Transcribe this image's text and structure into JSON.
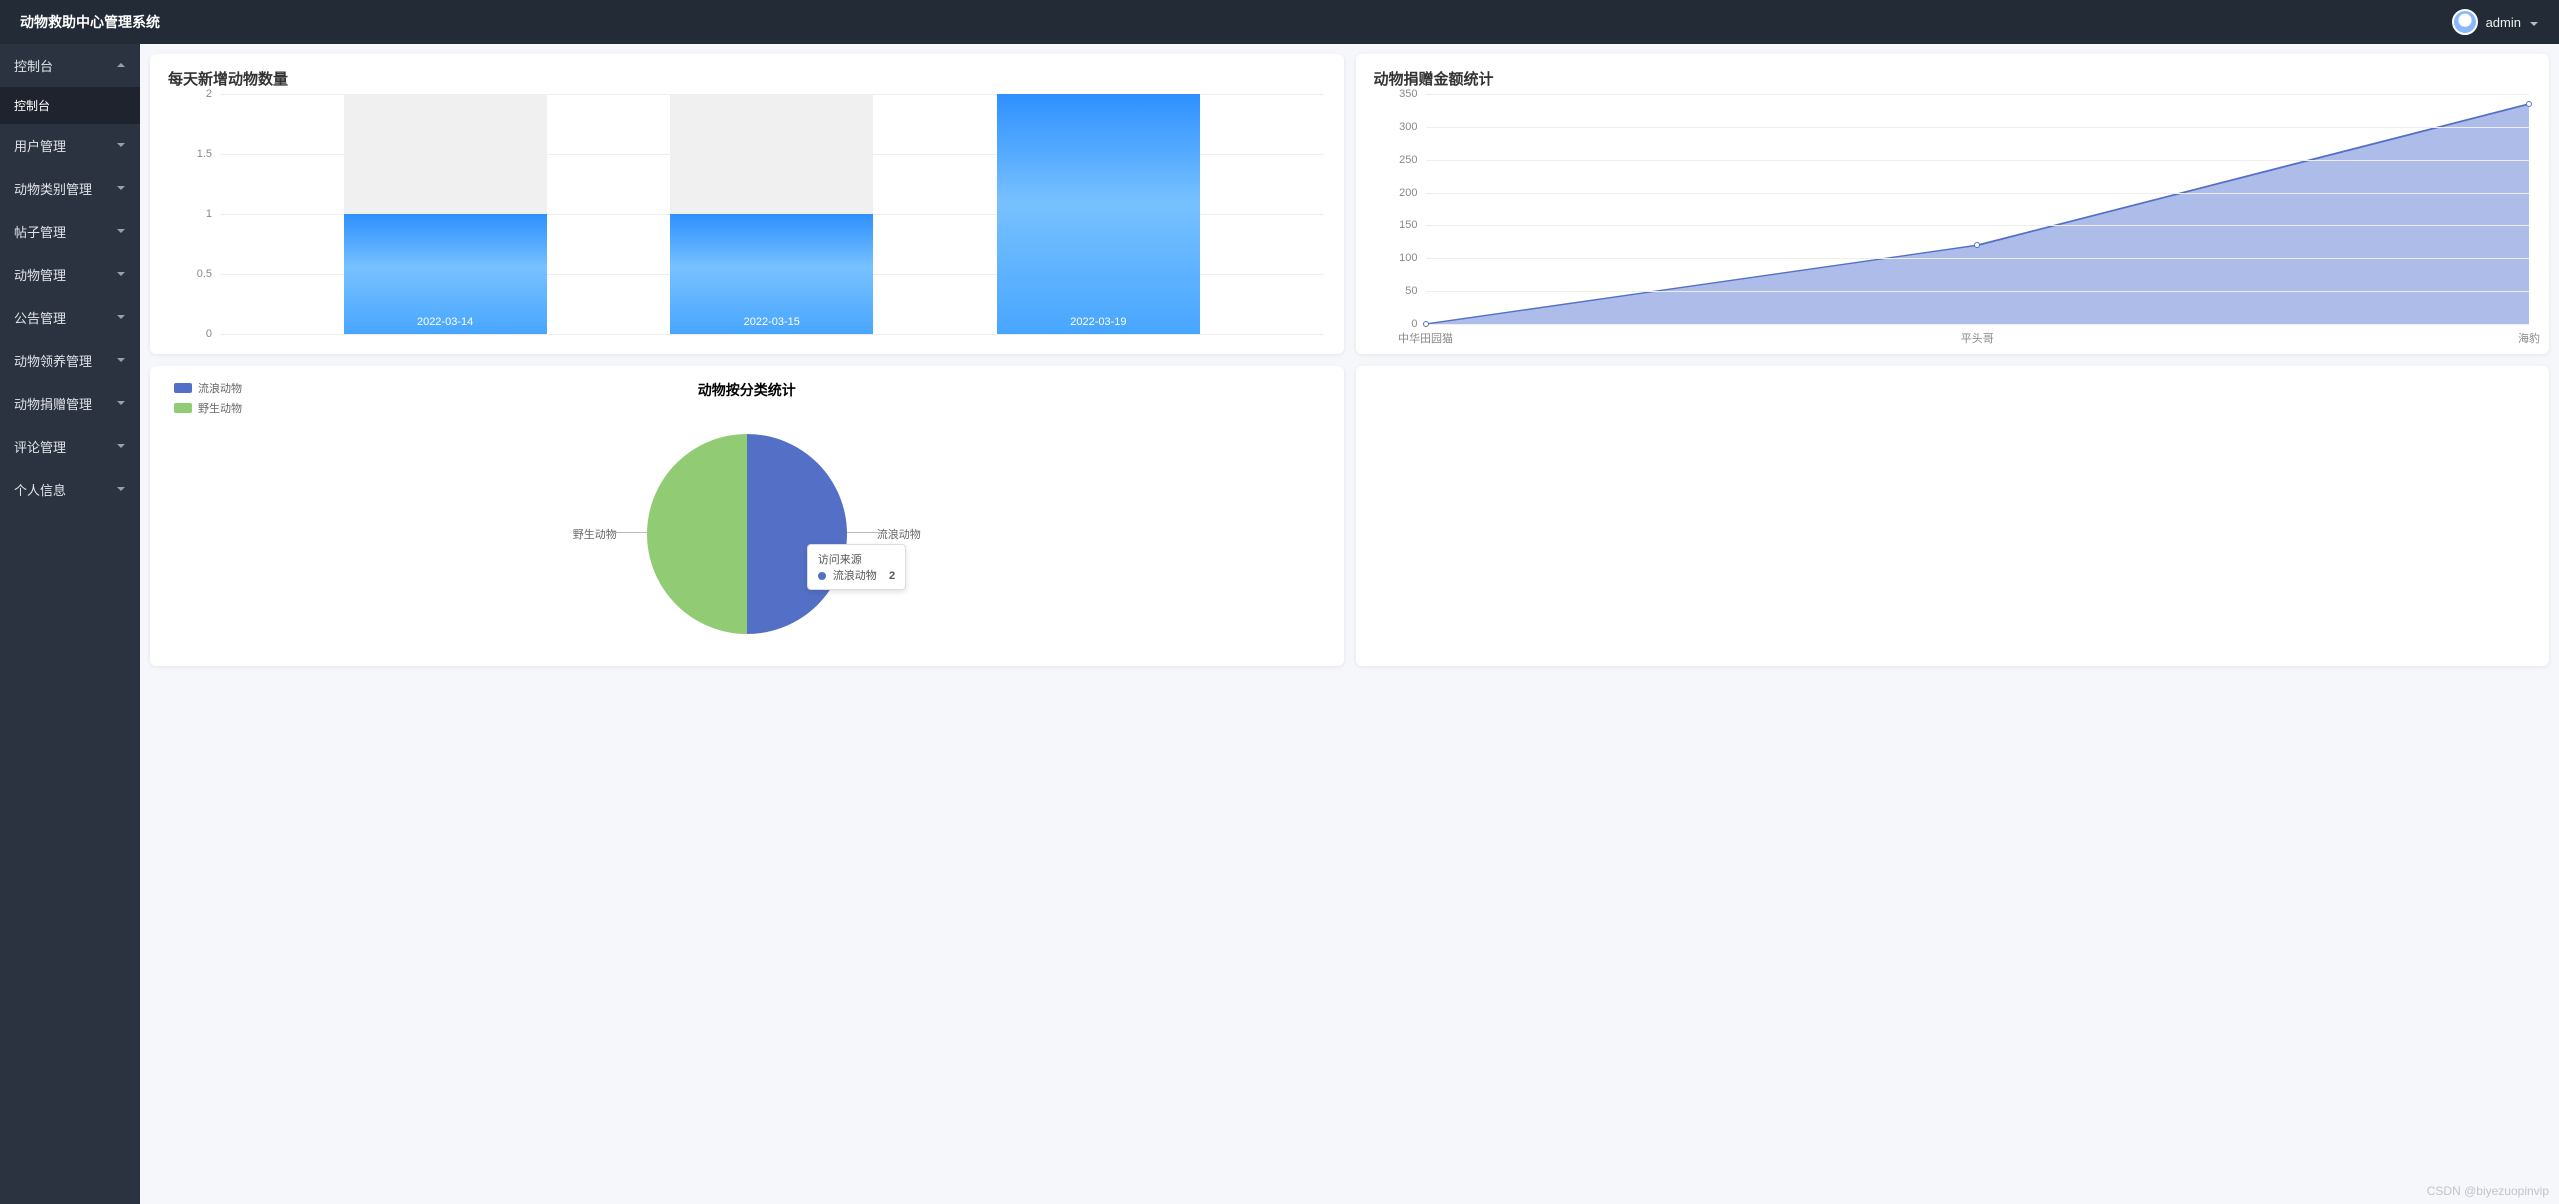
{
  "app": {
    "title": "动物救助中心管理系统"
  },
  "header": {
    "username": "admin"
  },
  "sidebar": {
    "expanded_group": "控制台",
    "items": [
      {
        "label": "控制台",
        "hasSub": true,
        "open": true,
        "sub": [
          {
            "label": "控制台",
            "active": true
          }
        ]
      },
      {
        "label": "用户管理",
        "hasSub": true
      },
      {
        "label": "动物类别管理",
        "hasSub": true
      },
      {
        "label": "帖子管理",
        "hasSub": true
      },
      {
        "label": "动物管理",
        "hasSub": true
      },
      {
        "label": "公告管理",
        "hasSub": true
      },
      {
        "label": "动物领养管理",
        "hasSub": true
      },
      {
        "label": "动物捐赠管理",
        "hasSub": true
      },
      {
        "label": "评论管理",
        "hasSub": true
      },
      {
        "label": "个人信息",
        "hasSub": true
      }
    ]
  },
  "cards": {
    "bar_title": "每天新增动物数量",
    "area_title": "动物捐赠金额统计",
    "pie_title": "动物按分类统计",
    "pie_legend_1": "流浪动物",
    "pie_legend_2": "野生动物",
    "pie_label_right": "流浪动物",
    "pie_label_left": "野生动物",
    "tooltip_title": "访问来源",
    "tooltip_series": "流浪动物",
    "tooltip_value": "2"
  },
  "watermark": "CSDN @biyezuopinvip",
  "chart_data": [
    {
      "type": "bar",
      "title": "每天新增动物数量",
      "categories": [
        "2022-03-14",
        "2022-03-15",
        "2022-03-19"
      ],
      "values": [
        1,
        1,
        2
      ],
      "ylim": [
        0,
        2
      ],
      "y_ticks": [
        0,
        0.5,
        1,
        1.5,
        2
      ],
      "xlabel": "",
      "ylabel": ""
    },
    {
      "type": "area",
      "title": "动物捐赠金额统计",
      "categories": [
        "中华田园猫",
        "平头哥",
        "海豹"
      ],
      "values": [
        0,
        120,
        335
      ],
      "ylim": [
        0,
        350
      ],
      "y_ticks": [
        0,
        50,
        100,
        150,
        200,
        250,
        300,
        350
      ],
      "xlabel": "",
      "ylabel": ""
    },
    {
      "type": "pie",
      "title": "动物按分类统计",
      "series": [
        {
          "name": "流浪动物",
          "value": 2,
          "color": "#5470c6"
        },
        {
          "name": "野生动物",
          "value": 2,
          "color": "#91cc75"
        }
      ],
      "tooltip": {
        "title": "访问来源",
        "name": "流浪动物",
        "value": 2
      }
    }
  ]
}
